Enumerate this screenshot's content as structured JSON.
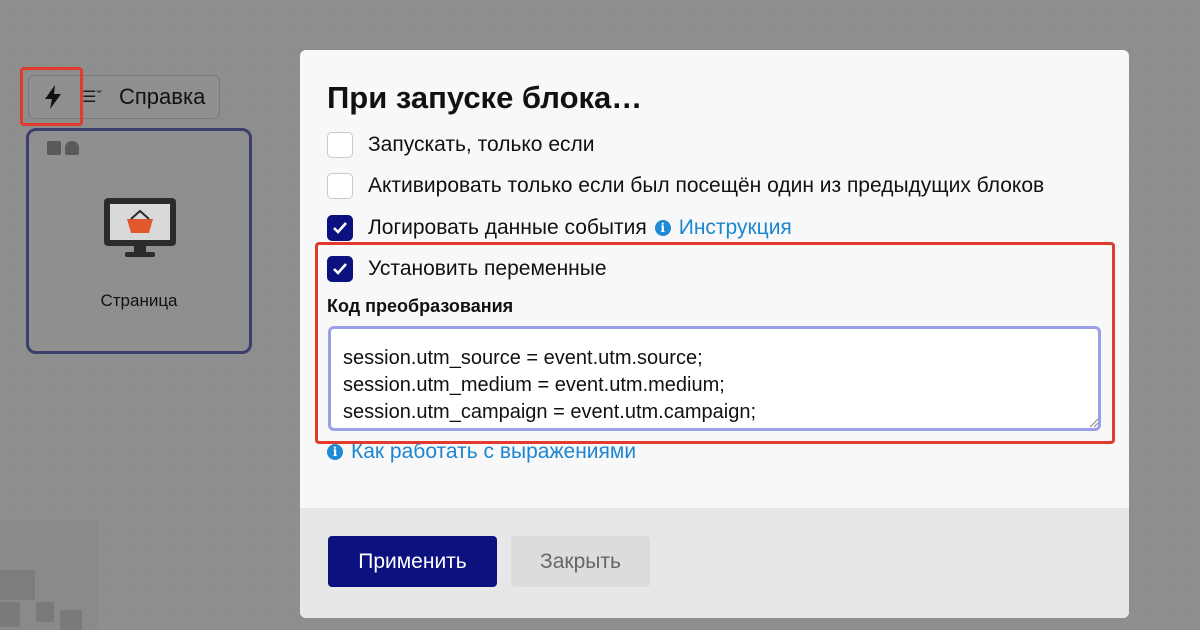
{
  "toolbar": {
    "trigger_icon": "lightning-bolt-icon",
    "list_icon": "list-dropdown-icon",
    "help_label": "Справка"
  },
  "canvas_block": {
    "icon": "monitor-basket-icon",
    "label": "Страница"
  },
  "modal": {
    "title": "При запуске блока…",
    "options": [
      {
        "label": "Запускать, только если",
        "checked": false
      },
      {
        "label": "Активировать только если был посещён один из предыдущих блоков",
        "checked": false
      },
      {
        "label": "Логировать данные события",
        "checked": true,
        "link": "Инструкция"
      },
      {
        "label": "Установить переменные",
        "checked": true
      }
    ],
    "code_label": "Код преобразования",
    "code_value": "session.utm_source = event.utm.source;\nsession.utm_medium = event.utm.medium;\nsession.utm_campaign = event.utm.campaign;",
    "help_link": "Как работать с выражениями",
    "apply_label": "Применить",
    "close_label": "Закрыть"
  },
  "colors": {
    "accent": "#0b1280",
    "link": "#1c86d0",
    "highlight": "#e23a2e"
  }
}
